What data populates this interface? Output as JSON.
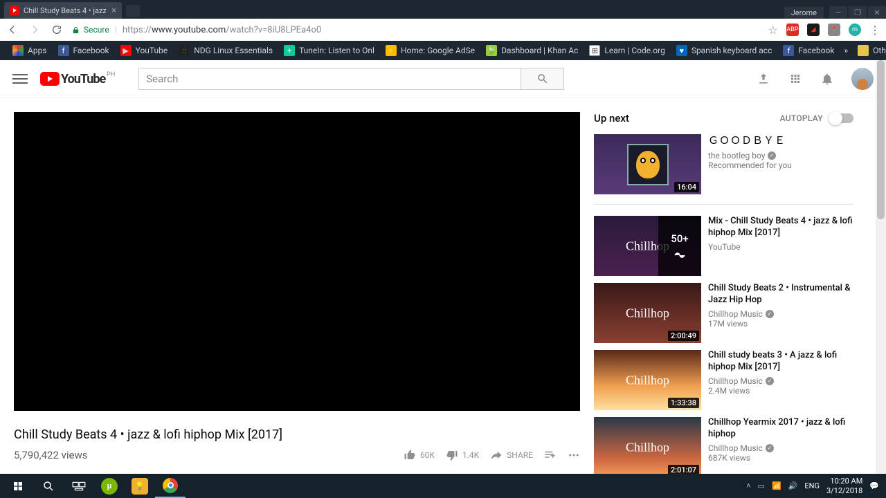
{
  "browser": {
    "tab_title": "Chill Study Beats 4 • jazz",
    "user": "Jerome",
    "secure_label": "Secure",
    "url_proto": "https://",
    "url_host": "www.youtube.com",
    "url_path": "/watch?v=8iU8LPEa4o0"
  },
  "bookmarks": {
    "apps": "Apps",
    "items": [
      "Facebook",
      "YouTube",
      "NDG Linux Essentials",
      "TuneIn: Listen to Onl",
      "Home: Google AdSe",
      "Dashboard | Khan Ac",
      "Learn | Code.org",
      "Spanish keyboard acc",
      "Facebook"
    ],
    "other": "Other bookmarks"
  },
  "yt": {
    "logo": "YouTube",
    "cc": "PH",
    "search_ph": "Search",
    "title": "Chill Study Beats 4 • jazz & lofi hiphop Mix [2017]",
    "views": "5,790,422 views",
    "like": "60K",
    "dislike": "1.4K",
    "share": "SHARE"
  },
  "side": {
    "upnext": "Up next",
    "autoplay": "AUTOPLAY",
    "first": {
      "title": "ＧＯＯＤＢＹＥ",
      "channel": "the bootleg boy",
      "sub": "Recommended for you",
      "dur": "16:04"
    },
    "recs": [
      {
        "title": "Mix - Chill Study Beats 4 • jazz & lofi hiphop Mix [2017]",
        "channel": "YouTube",
        "views": "",
        "dur": "",
        "mix": "50+",
        "verified": false,
        "bg": "linear-gradient(180deg,#2a1a3a,#4a2050)"
      },
      {
        "title": "Chill Study Beats 2 • Instrumental & Jazz Hip Hop",
        "channel": "Chillhop Music",
        "views": "17M views",
        "dur": "2:00:49",
        "verified": true,
        "bg": "linear-gradient(180deg,#3a1818,#8a4030)"
      },
      {
        "title": "Chill study beats 3 • A jazz & lofi hiphop Mix [2017]",
        "channel": "Chillhop Music",
        "views": "2.4M views",
        "dur": "1:33:38",
        "verified": true,
        "bg": "linear-gradient(180deg,#5a2818,#f0a050 60%,#ffe0a0)"
      },
      {
        "title": "Chillhop Yearmix 2017 • jazz & lofi hiphop",
        "channel": "Chillhop Music",
        "views": "687K views",
        "dur": "2:01:07",
        "verified": true,
        "bg": "linear-gradient(180deg,#2a3848,#d06840 70%,#f0a060)"
      }
    ]
  },
  "taskbar": {
    "lang": "ENG",
    "time": "10:20 AM",
    "date": "3/12/2018"
  }
}
